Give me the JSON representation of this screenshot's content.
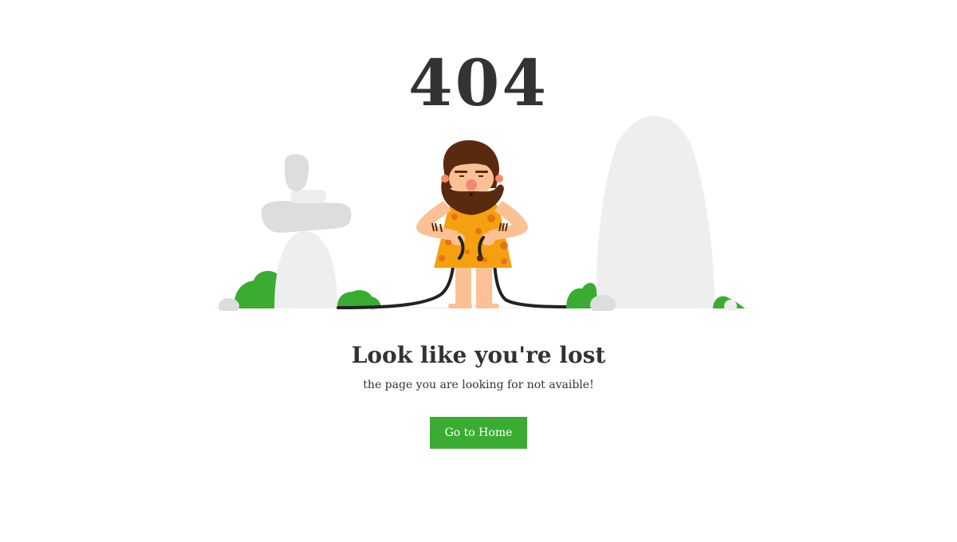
{
  "error": {
    "code": "404",
    "headline": "Look like you're lost",
    "message": "the page you are looking for not avaible!"
  },
  "actions": {
    "home_label": "Go to Home"
  },
  "illustration": {
    "subject": "caveman-holding-unplugged-cable",
    "colors": {
      "rock": "#eeeeee",
      "rock_dark": "#dddddd",
      "bush": "#39ac31",
      "skin": "#fbc195",
      "hair": "#5a2a0e",
      "tunic": "#f5a00f",
      "tunic_spots": "#e8721a",
      "cable": "#222222"
    }
  },
  "theme": {
    "accent": "#39ac31",
    "text": "#333333",
    "background": "#ffffff"
  }
}
